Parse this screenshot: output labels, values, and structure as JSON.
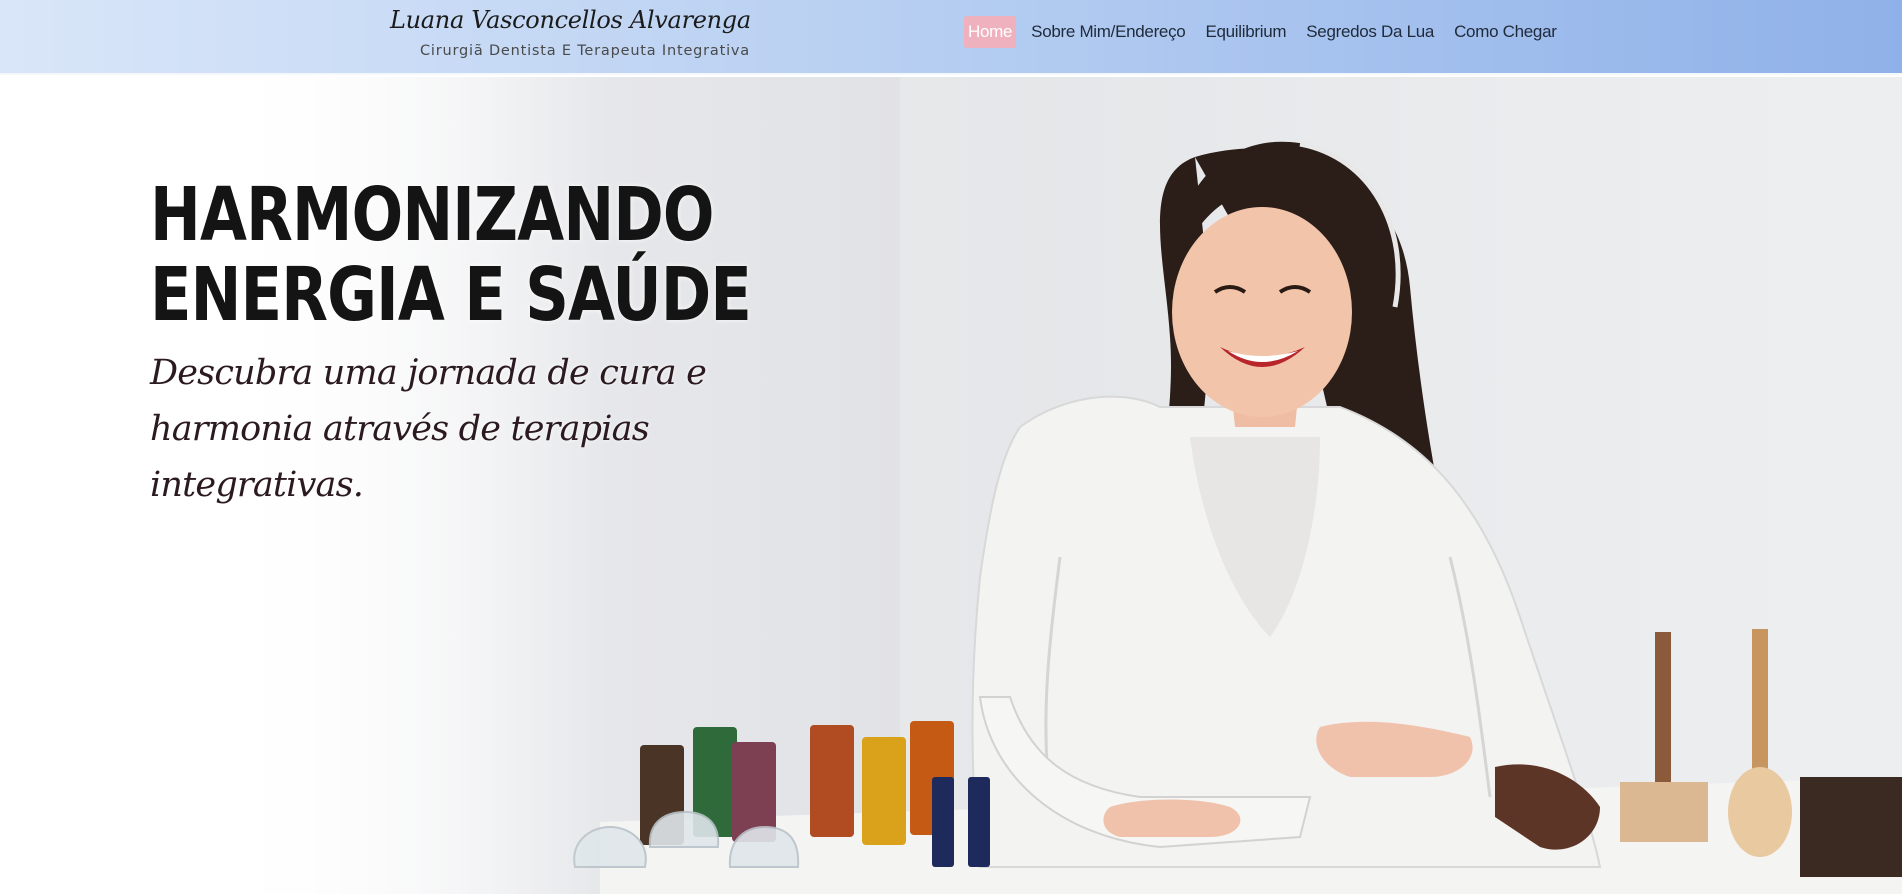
{
  "header": {
    "brand_name": "Luana Vasconcellos Alvarenga",
    "tagline": "Cirurgiã Dentista E Terapeuta Integrativa",
    "nav": [
      {
        "label": "Home",
        "active": true
      },
      {
        "label": "Sobre Mim/Endereço",
        "active": false
      },
      {
        "label": "Equilibrium",
        "active": false
      },
      {
        "label": "Segredos Da Lua",
        "active": false
      },
      {
        "label": "Como Chegar",
        "active": false
      }
    ]
  },
  "hero": {
    "title_line1": "HARMONIZANDO",
    "title_line2": "ENERGIA E SAÚDE",
    "subtitle": "Descubra uma jornada de cura e harmonia através de terapias integrativas.",
    "image": "therapist-portrait-with-aromatherapy-products"
  },
  "colors": {
    "nav_active_bg": "#efb1bd",
    "header_gradient_start": "#d9e6f9",
    "header_gradient_end": "#8fb1e9",
    "title_text": "#141414"
  }
}
